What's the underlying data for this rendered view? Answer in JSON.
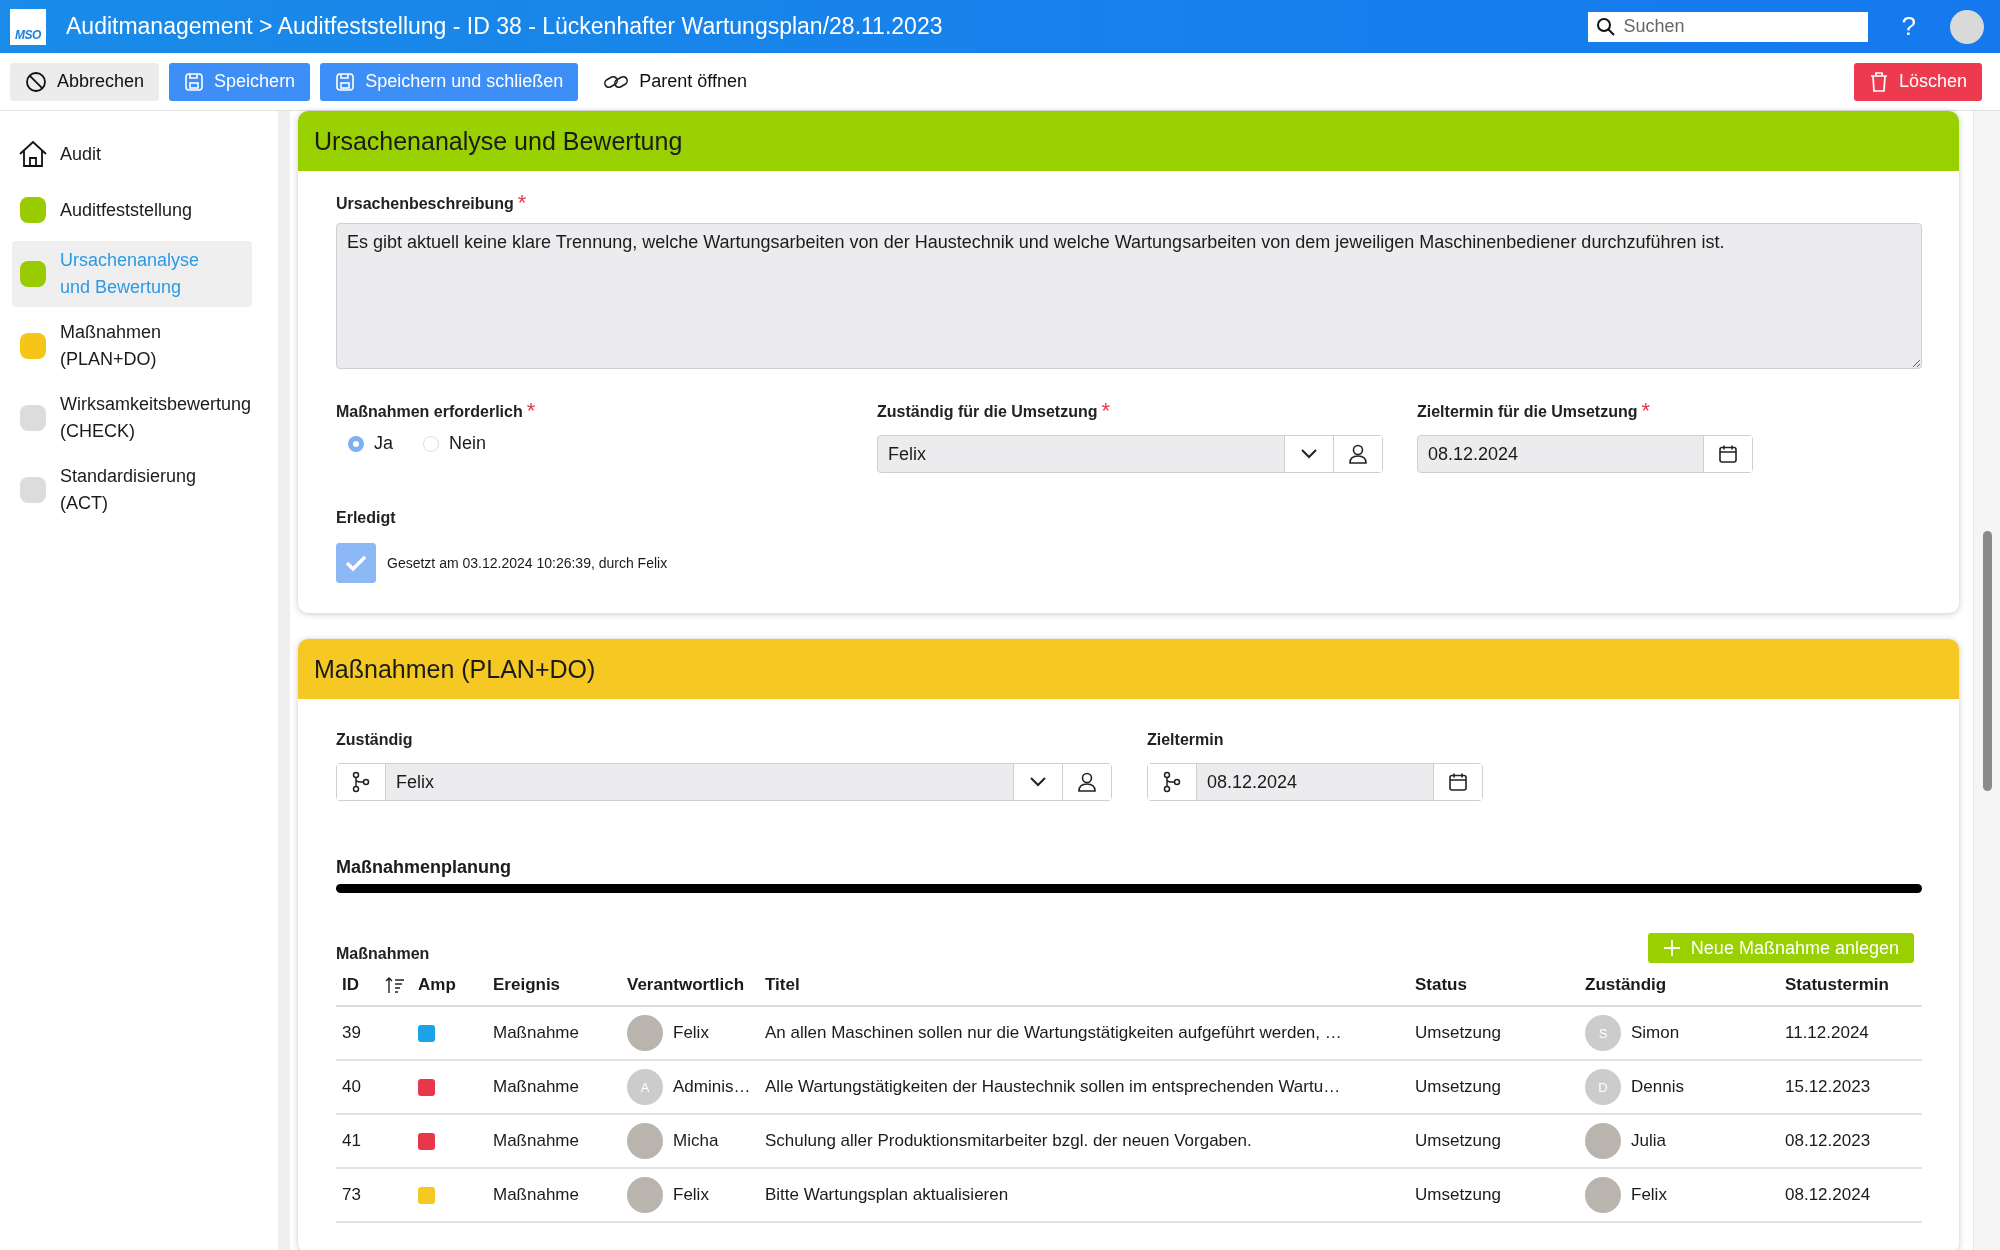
{
  "header": {
    "logo": "MSO",
    "title": "Auditmanagement > Auditfeststellung - ID 38 - Lückenhafter Wartungsplan/28.11.2023",
    "search": {
      "placeholder": "Suchen"
    },
    "help": "?"
  },
  "toolbar": {
    "cancel": "Abbrechen",
    "save": "Speichern",
    "save_close": "Speichern und schließen",
    "parent": "Parent öffnen",
    "delete": "Löschen"
  },
  "sidebar": {
    "items": [
      {
        "kind": "home",
        "label": "Audit",
        "selected": false
      },
      {
        "kind": "phase",
        "label": "Auditfeststellung",
        "color": "#99cc00",
        "selected": false
      },
      {
        "kind": "phase",
        "label": "Ursachenanalyse und Bewertung",
        "color": "#99cc00",
        "selected": true
      },
      {
        "kind": "phase",
        "label": "Maßnahmen (PLAN+DO)",
        "color": "#f5c518",
        "selected": false
      },
      {
        "kind": "phase",
        "label": "Wirksamkeitsbewertung (CHECK)",
        "color": "#dcdcdc",
        "selected": false
      },
      {
        "kind": "phase",
        "label": "Standardisierung (ACT)",
        "color": "#dcdcdc",
        "selected": false
      }
    ]
  },
  "cause_section": {
    "title": "Ursachenanalyse und Bewertung",
    "description": {
      "label": "Ursachenbeschreibung",
      "required_mark": "*",
      "value": "Es gibt aktuell keine klare Trennung, welche Wartungsarbeiten von der Haustechnik und welche Wartungsarbeiten von dem jeweiligen Maschinenbediener durchzuführen ist."
    },
    "measures_required": {
      "label": "Maßnahmen erforderlich",
      "required_mark": "*",
      "options": [
        {
          "label": "Ja",
          "selected": true
        },
        {
          "label": "Nein",
          "selected": false
        }
      ]
    },
    "responsible": {
      "label": "Zuständig für die Umsetzung",
      "required_mark": "*",
      "value": "Felix"
    },
    "due_date": {
      "label": "Zieltermin für die Umsetzung",
      "required_mark": "*",
      "value": "08.12.2024"
    },
    "done": {
      "label": "Erledigt",
      "checked": true,
      "note": "Gesetzt am 03.12.2024 10:26:39, durch Felix"
    }
  },
  "measures_section": {
    "title": "Maßnahmen (PLAN+DO)",
    "responsible": {
      "label": "Zuständig",
      "value": "Felix"
    },
    "due_date": {
      "label": "Zieltermin",
      "value": "08.12.2024"
    },
    "planning_title": "Maßnahmenplanung",
    "table_title": "Maßnahmen",
    "new_button": "Neue Maßnahme anlegen",
    "columns": [
      "ID",
      "Amp",
      "Ereignis",
      "Verantwortlich",
      "Titel",
      "Status",
      "Zuständig",
      "Statustermin"
    ],
    "rows": [
      {
        "id": "39",
        "color": "#1aa3e8",
        "event": "Maßnahme",
        "owner": {
          "name": "Felix",
          "kind": "photo"
        },
        "title": "An allen Maschinen sollen nur die Wartungstätigkeiten aufgeführt werden, …",
        "status": "Umsetzung",
        "assignee": {
          "name": "Simon",
          "kind": "initial",
          "initial": "S"
        },
        "status_date": "11.12.2024"
      },
      {
        "id": "40",
        "color": "#e8374a",
        "event": "Maßnahme",
        "owner": {
          "name": "Adminis…",
          "kind": "initial",
          "initial": "A"
        },
        "title": "Alle Wartungstätigkeiten der Haustechnik sollen im entsprechenden Wartu…",
        "status": "Umsetzung",
        "assignee": {
          "name": "Dennis",
          "kind": "initial",
          "initial": "D"
        },
        "status_date": "15.12.2023"
      },
      {
        "id": "41",
        "color": "#e8374a",
        "event": "Maßnahme",
        "owner": {
          "name": "Micha",
          "kind": "photo"
        },
        "title": "Schulung aller Produktionsmitarbeiter bzgl. der neuen Vorgaben.",
        "status": "Umsetzung",
        "assignee": {
          "name": "Julia",
          "kind": "photo"
        },
        "status_date": "08.12.2023"
      },
      {
        "id": "73",
        "color": "#f5c823",
        "event": "Maßnahme",
        "owner": {
          "name": "Felix",
          "kind": "photo"
        },
        "title": "Bitte Wartungsplan aktualisieren",
        "status": "Umsetzung",
        "assignee": {
          "name": "Felix",
          "kind": "photo"
        },
        "status_date": "08.12.2024"
      }
    ]
  }
}
